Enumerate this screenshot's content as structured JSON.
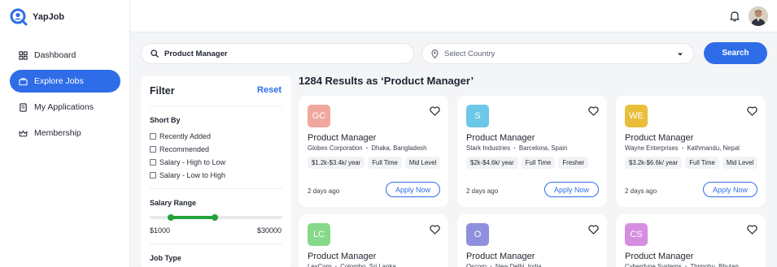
{
  "app": {
    "name": "YapJob"
  },
  "sidebar": {
    "items": [
      {
        "label": "Dashboard",
        "active": false
      },
      {
        "label": "Explore Jobs",
        "active": true
      },
      {
        "label": "My Applications",
        "active": false
      },
      {
        "label": "Membership",
        "active": false
      }
    ]
  },
  "search": {
    "query": "Product Manager",
    "country_placeholder": "Select Country",
    "button_label": "Search"
  },
  "filter": {
    "title": "Filter",
    "reset_label": "Reset",
    "sort_title": "Short By",
    "sort_options": [
      "Recently Added",
      "Recommended",
      "Salary - High to Low",
      "Salary - Low to High"
    ],
    "salary_title": "Salary Range",
    "salary_min": "$1000",
    "salary_max": "$30000",
    "salary_selected_fraction": [
      0.16,
      0.49
    ],
    "job_type_title": "Job Type"
  },
  "results": {
    "title": "1284 Results as ‘Product Manager’",
    "jobs": [
      {
        "logo": "GC",
        "logo_color": "#f0a79e",
        "title": "Product Manager",
        "company": "Globex Corporation",
        "location": "Dhaka, Bangladesh",
        "salary": "$1.2k-$3.4k/ year",
        "type": "Full Time",
        "level": "Mid Level",
        "posted": "2 days ago",
        "apply_label": "Apply Now"
      },
      {
        "logo": "S",
        "logo_color": "#6cc7e8",
        "title": "Product Manager",
        "company": "Stark Industries",
        "location": "Barcelona, Spain",
        "salary": "$2k-$4.6k/ year",
        "type": "Full Time",
        "level": "Fresher",
        "posted": "2 days ago",
        "apply_label": "Apply Now"
      },
      {
        "logo": "WE",
        "logo_color": "#e9bf3a",
        "title": "Product Manager",
        "company": "Wayne Enterprises",
        "location": "Kathmandu, Nepal",
        "salary": "$3.2k-$6.6k/ year",
        "type": "Full Time",
        "level": "Mid Level",
        "posted": "2 days ago",
        "apply_label": "Apply Now"
      },
      {
        "logo": "LC",
        "logo_color": "#86d98a",
        "title": "Product Manager",
        "company": "LexCorp",
        "location": "Colombo, Sri Lanka",
        "salary": "",
        "type": "",
        "level": "",
        "posted": "",
        "apply_label": ""
      },
      {
        "logo": "O",
        "logo_color": "#8f90dd",
        "title": "Product Manager",
        "company": "Oscorp",
        "location": "New Delhi, India",
        "salary": "",
        "type": "",
        "level": "",
        "posted": "",
        "apply_label": ""
      },
      {
        "logo": "CS",
        "logo_color": "#d58ee0",
        "title": "Product Manager",
        "company": "Cyberdyne Systems",
        "location": "Thimphu, Bhutan",
        "salary": "",
        "type": "",
        "level": "",
        "posted": "",
        "apply_label": ""
      }
    ]
  },
  "colors": {
    "accent": "#2f6de8",
    "slider": "#23a33a"
  }
}
